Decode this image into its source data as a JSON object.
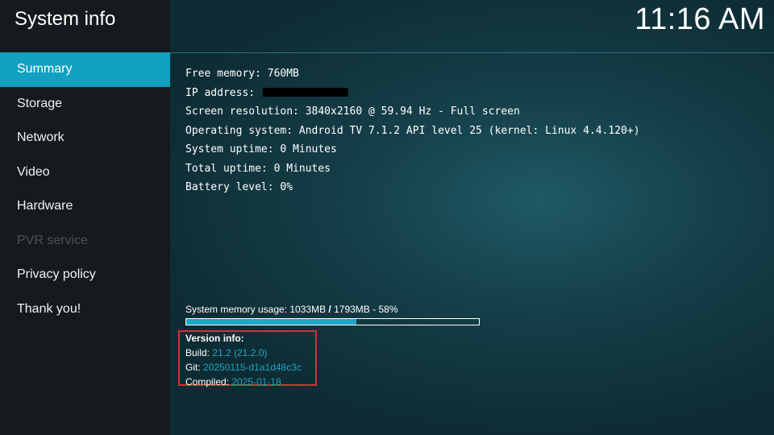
{
  "header": {
    "title": "System info",
    "clock": "11:16 AM"
  },
  "sidebar": {
    "items": [
      {
        "label": "Summary",
        "state": "active"
      },
      {
        "label": "Storage",
        "state": "normal"
      },
      {
        "label": "Network",
        "state": "normal"
      },
      {
        "label": "Video",
        "state": "normal"
      },
      {
        "label": "Hardware",
        "state": "normal"
      },
      {
        "label": "PVR service",
        "state": "disabled"
      },
      {
        "label": "Privacy policy",
        "state": "normal"
      },
      {
        "label": "Thank you!",
        "state": "normal"
      }
    ]
  },
  "summary": {
    "free_memory": "Free memory: 760MB",
    "ip_address_label": "IP address:",
    "screen_resolution": "Screen resolution: 3840x2160 @ 59.94 Hz - Full screen",
    "operating_system": "Operating system: Android TV 7.1.2 API level 25 (kernel: Linux 4.4.120+)",
    "system_uptime": "System uptime: 0 Minutes",
    "total_uptime": "Total uptime: 0 Minutes",
    "battery_level": "Battery level: 0%"
  },
  "memory": {
    "prefix": "System memory usage: 1033MB",
    "separator": "/",
    "suffix": "1793MB - 58%",
    "usage_percent": 58
  },
  "version": {
    "title": "Version info:",
    "build_label": "Build:",
    "build_value": "21.2 (21.2.0)",
    "git_label": "Git:",
    "git_value": "20250115-d1a1d48c3c",
    "compiled_label": "Compiled:",
    "compiled_value": "2025-01-18"
  },
  "colors": {
    "accent": "#12a1c0",
    "highlight_box": "#d2332f",
    "sidebar_bg": "#151a1d",
    "version_value": "#1fa4c1"
  }
}
